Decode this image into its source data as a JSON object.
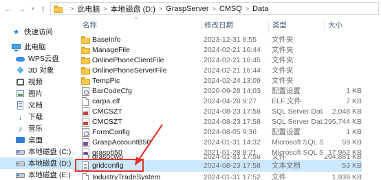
{
  "address_bar": {
    "back_icon": "arrow-left-icon",
    "forward_icon": "arrow-right-icon",
    "up_icon": "arrow-up-icon",
    "breadcrumbs": [
      "此电脑",
      "本地磁盘 (D:)",
      "GraspServer",
      "CMSQ",
      "Data"
    ]
  },
  "nav_pane": {
    "items": [
      {
        "label": "快速访问",
        "icon": "star-icon"
      },
      {
        "label": "此电脑",
        "icon": "computer-icon"
      },
      {
        "label": "WPS云盘",
        "icon": "cloud-icon"
      },
      {
        "label": "3D 对象",
        "icon": "3d-objects-icon"
      },
      {
        "label": "视频",
        "icon": "video-icon"
      },
      {
        "label": "图片",
        "icon": "pictures-icon"
      },
      {
        "label": "文档",
        "icon": "documents-icon"
      },
      {
        "label": "下载",
        "icon": "download-icon"
      },
      {
        "label": "音乐",
        "icon": "music-icon"
      },
      {
        "label": "桌面",
        "icon": "desktop-icon"
      },
      {
        "label": "本地磁盘 (C:)",
        "icon": "drive-icon"
      },
      {
        "label": "本地磁盘 (D:)",
        "icon": "drive-icon"
      },
      {
        "label": "本地磁盘 (E:)",
        "icon": "drive-icon"
      }
    ],
    "selected_index": 11
  },
  "columns": {
    "name": "名称",
    "date": "修改日期",
    "type": "类型",
    "size": "大小"
  },
  "files": [
    {
      "name": "BaseInfo",
      "date": "2023-12-31 8:55",
      "type": "文件夹",
      "size": "",
      "icon": "folder"
    },
    {
      "name": "ManageFile",
      "date": "2024-02-21 16:44",
      "type": "文件夹",
      "size": "",
      "icon": "folder"
    },
    {
      "name": "OnlinePhoneClientFile",
      "date": "2024-02-21 16:45",
      "type": "文件夹",
      "size": "",
      "icon": "folder"
    },
    {
      "name": "OnlinePhoneServerFile",
      "date": "2024-02-21 16:44",
      "type": "文件夹",
      "size": "",
      "icon": "folder"
    },
    {
      "name": "TempPic",
      "date": "2024-02-24 13:09",
      "type": "文件夹",
      "size": "",
      "icon": "folder"
    },
    {
      "name": "BarCodeCfg",
      "date": "2020-09-28 14:03",
      "type": "配置设置",
      "size": "1 KB",
      "icon": "cfg"
    },
    {
      "name": "carpa.elf",
      "date": "2024-04-28 9:27",
      "type": "ELF 文件",
      "size": "7 KB",
      "icon": "doc"
    },
    {
      "name": "CMCSZT",
      "date": "2024-08-23 17:58",
      "type": "SQL Server Data...",
      "size": "2,048 KB",
      "icon": "sql"
    },
    {
      "name": "CMCSZT",
      "date": "2024-08-23 17:58",
      "type": "SQL Server Data...",
      "size": "295,744 KB",
      "icon": "sql"
    },
    {
      "name": "FormConfig",
      "date": "2024-08-05 9:36",
      "type": "配置设置",
      "size": "1 KB",
      "icon": "cfg"
    },
    {
      "name": "GraspAccountB50",
      "date": "2024-01-31 14:32",
      "type": "Microsoft SQL S...",
      "size": "59 KB",
      "icon": "db"
    },
    {
      "name": "graspb50",
      "date": "2021-01-28 8:21",
      "type": "Microsoft SQL S...",
      "size": "17,962 KB",
      "icon": "db"
    },
    {
      "name": "graspcwb",
      "date": "2024-01-31 17:58",
      "type": "文件",
      "size": "204,881 KB",
      "icon": "doc"
    },
    {
      "name": "gridconfig",
      "date": "2024-08-23 17:58",
      "type": "文本文档",
      "size": "53 KB",
      "icon": "txt"
    },
    {
      "name": "IndustryTradeSystem",
      "date": "2024-01-31 17:52",
      "type": "文件",
      "size": "1,939 KB",
      "icon": "doc"
    }
  ],
  "selected_file_index": 13,
  "annotation": {
    "color": "#e8322b",
    "target": "gridconfig"
  },
  "colors": {
    "selection": "#cce8ff",
    "header_text": "#4c607a",
    "folder": "#f7ca4f"
  }
}
